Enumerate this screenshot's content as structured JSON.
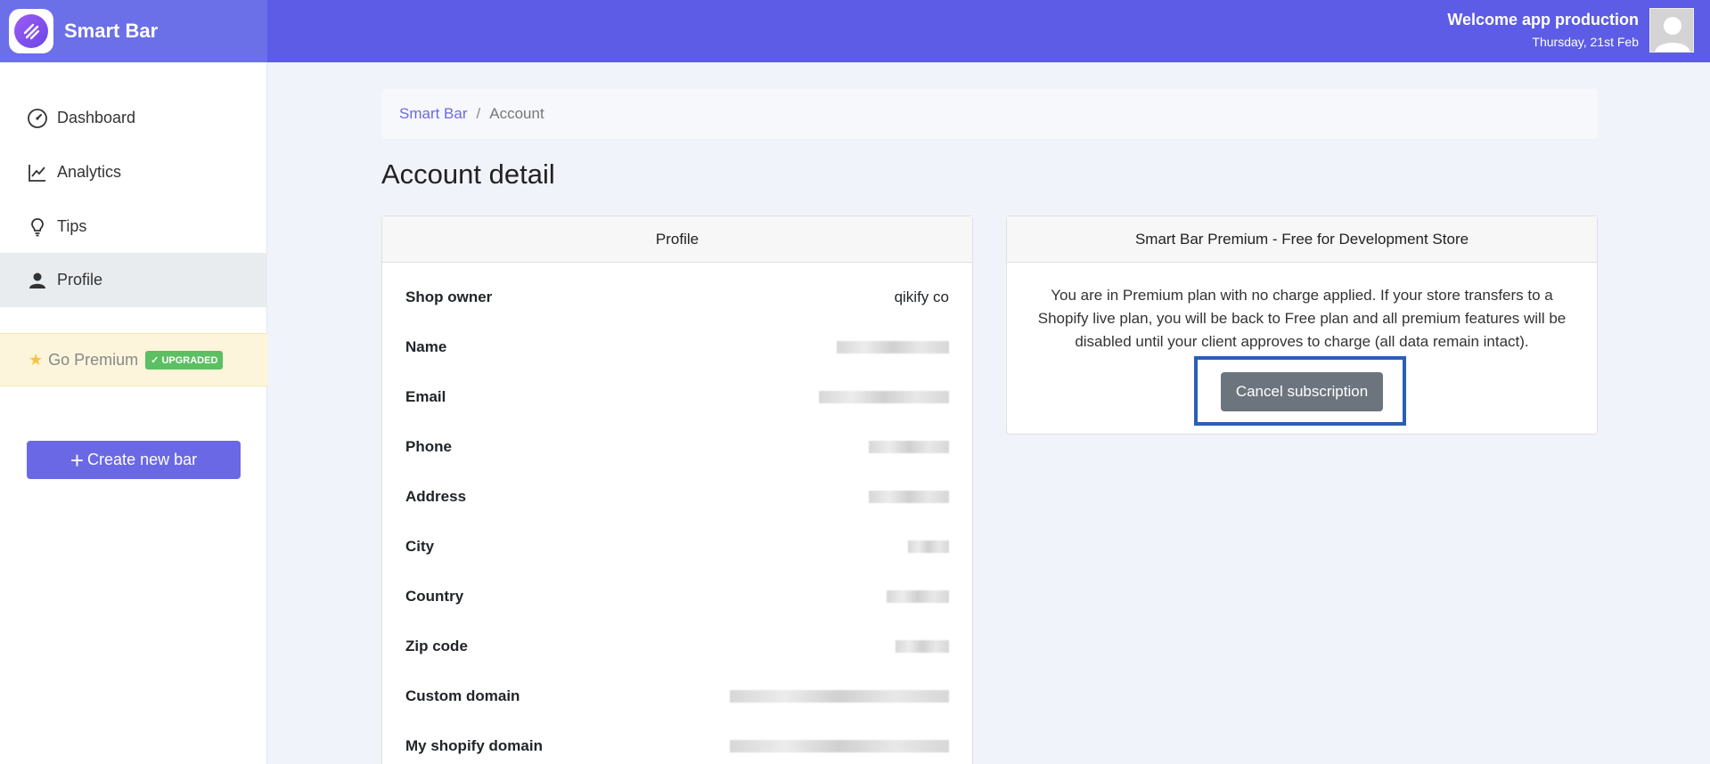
{
  "header": {
    "brand": "Smart Bar",
    "welcome": "Welcome app production",
    "date": "Thursday, 21st Feb"
  },
  "sidebar": {
    "items": [
      {
        "label": "Dashboard",
        "icon": "speedometer-icon"
      },
      {
        "label": "Analytics",
        "icon": "chart-line-icon"
      },
      {
        "label": "Tips",
        "icon": "lightbulb-icon"
      },
      {
        "label": "Profile",
        "icon": "user-icon",
        "active": true
      }
    ],
    "premium_label": "Go Premium",
    "premium_badge": "UPGRADED",
    "create_label": "Create new bar"
  },
  "breadcrumb": {
    "root": "Smart Bar",
    "separator": "/",
    "current": "Account"
  },
  "page_title": "Account detail",
  "profile": {
    "title": "Profile",
    "rows": [
      {
        "label": "Shop owner",
        "value": "qikify co"
      },
      {
        "label": "Name",
        "value": ""
      },
      {
        "label": "Email",
        "value": ""
      },
      {
        "label": "Phone",
        "value": ""
      },
      {
        "label": "Address",
        "value": ""
      },
      {
        "label": "City",
        "value": ""
      },
      {
        "label": "Country",
        "value": ""
      },
      {
        "label": "Zip code",
        "value": ""
      },
      {
        "label": "Custom domain",
        "value": ""
      },
      {
        "label": "My shopify domain",
        "value": ""
      }
    ]
  },
  "premium_card": {
    "title": "Smart Bar Premium - Free for Development Store",
    "description": "You are in Premium plan with no charge applied. If your store transfers to a Shopify live plan, you will be back to Free plan and all premium features will be disabled until your client approves to charge (all data remain intact).",
    "cancel_label": "Cancel subscription"
  },
  "colors": {
    "header": "#5c5ce6",
    "accent": "#6b68e6",
    "badge": "#5cbf62",
    "highlight": "#2a5fb4"
  }
}
